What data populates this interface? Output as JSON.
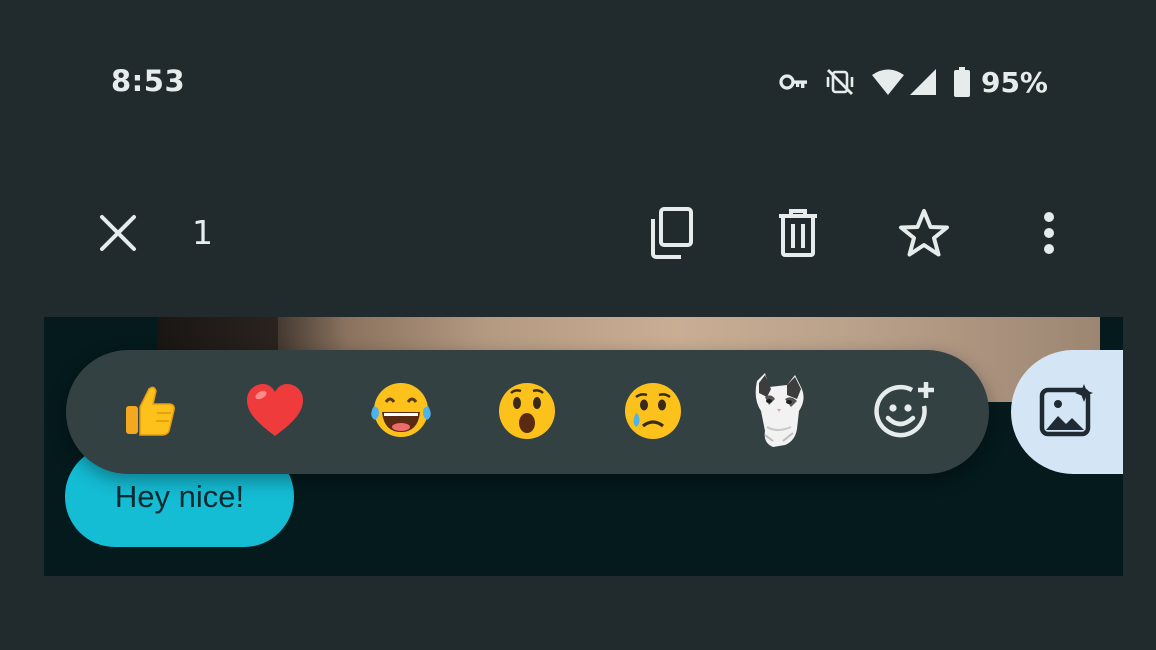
{
  "status_bar": {
    "time": "8:53",
    "battery_percent": "95%"
  },
  "selection": {
    "count": "1"
  },
  "message": {
    "text": "Hey nice!"
  },
  "colors": {
    "background": "#212b2d",
    "reaction_bar": "#334143",
    "bubble": "#14bcd4",
    "side_button": "#d4e6f5"
  },
  "icons": {
    "status": [
      "vpn-key-icon",
      "vibrate-off-icon",
      "wifi-icon",
      "signal-icon",
      "battery-icon"
    ],
    "actions": [
      "close-icon",
      "copy-icon",
      "delete-icon",
      "star-icon",
      "more-vert-icon"
    ],
    "reactions": [
      "thumbs-up-emoji",
      "red-heart-emoji",
      "tears-of-joy-emoji",
      "surprised-emoji",
      "sad-tear-emoji",
      "cat-sticker",
      "add-emoji-icon"
    ],
    "side": "photo-sparkle-icon"
  }
}
